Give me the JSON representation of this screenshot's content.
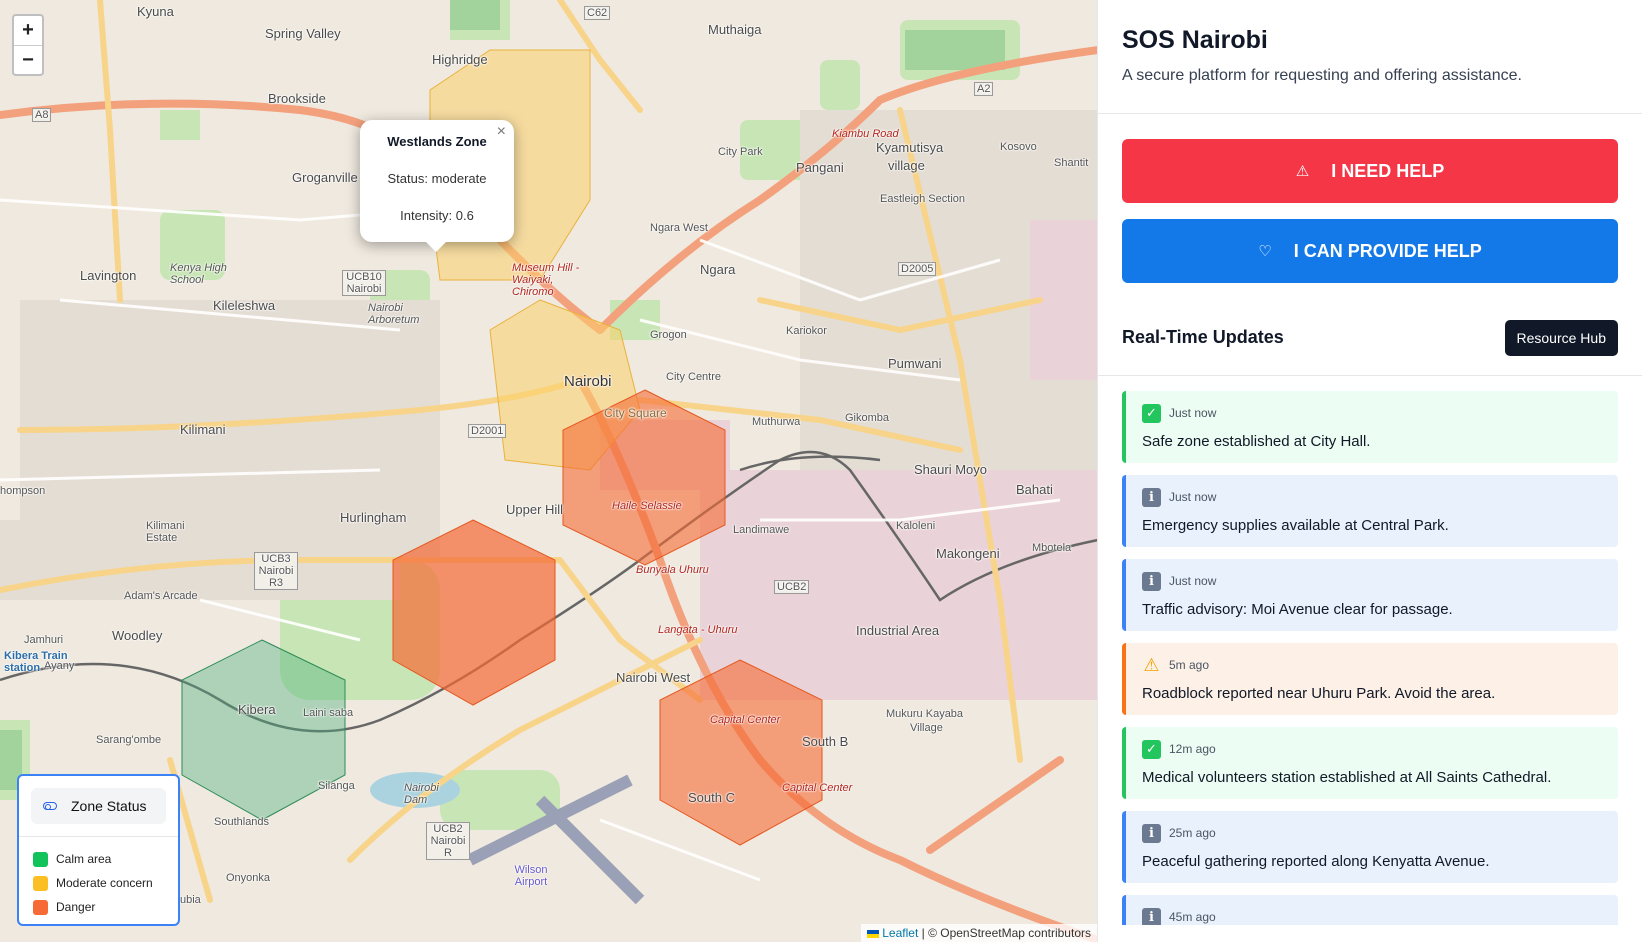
{
  "map": {
    "zoom_in": "+",
    "zoom_out": "−",
    "popup": {
      "title": "Westlands Zone",
      "status": "Status: moderate",
      "intensity": "Intensity: 0.6",
      "close": "×"
    },
    "legend": {
      "title": "Zone Status",
      "items": [
        {
          "label": "Calm area",
          "color": "#12c25a"
        },
        {
          "label": "Moderate concern",
          "color": "#fbbf24"
        },
        {
          "label": "Danger",
          "color": "#f56a36"
        }
      ]
    },
    "attribution": {
      "leaflet": "Leaflet",
      "rest": " | © OpenStreetMap contributors"
    },
    "labels": {
      "kyuna": "Kyuna",
      "spring_valley": "Spring Valley",
      "highridge": "Highridge",
      "muthaiga": "Muthaiga",
      "brookside": "Brookside",
      "groganville": "Groganville",
      "lavington": "Lavington",
      "kileleshwa": "Kileleshwa",
      "ngara_west": "Ngara West",
      "ngara": "Ngara",
      "pangani": "Pangani",
      "kyamutisya": "Kyamutisya",
      "village": "village",
      "eastleigh_section": "Eastleigh Section",
      "kosovo": "Kosovo",
      "shantit": "Shantit",
      "kariokor": "Kariokor",
      "pumwani": "Pumwani",
      "grogon": "Grogon",
      "city_centre": "City Centre",
      "nairobi": "Nairobi",
      "kilimani": "Kilimani",
      "muthurwa": "Muthurwa",
      "gikomba": "Gikomba",
      "shauri_moyo": "Shauri Moyo",
      "bahati": "Bahati",
      "upper_hill": "Upper Hill",
      "hurlingham": "Hurlingham",
      "landimawe": "Landimawe",
      "kaloleni": "Kaloleni",
      "makongeni": "Makongeni",
      "mbotela": "Mbotela",
      "industrial_area": "Industrial Area",
      "adams_arcade": "Adam's Arcade",
      "woodley": "Woodley",
      "jamhuri": "Jamhuri",
      "kibera": "Kibera",
      "laini_saba": "Laini saba",
      "nairobi_west": "Nairobi West",
      "south_b": "South B",
      "south_c": "South C",
      "mukuru": "Mukuru Kayaba",
      "mukuru_village": "Village",
      "sarangombe": "Sarang'ombe",
      "silanga": "Silanga",
      "southlands": "Southlands",
      "onyonka": "Onyonka",
      "city_park": "City Park",
      "ucb10": "UCB10 Nairobi",
      "ucb3": "UCB3 Nairobi R3",
      "ucb2a": "UCB2",
      "ucb2b": "UCB2 Nairobi R",
      "d2001": "D2001",
      "d2005": "D2005",
      "a8": "A8",
      "a2": "A2",
      "c62": "C62",
      "wilson": "Wilson Airport",
      "kibera_station": "Kibera Train station",
      "museum_hill": "Museum Hill - Waiyaki, Chiromo",
      "haile": "Haile Selassie",
      "bunyala": "Bunyala Uhuru",
      "langata": "Langata - Uhuru",
      "capital_centre": "Capital Center",
      "kiambu_road": "Kiambu Road",
      "city_square": "City Square",
      "ayany": "Ayany",
      "thompson": "hompson",
      "nairobi_dam": "Nairobi Dam",
      "kilimani_estate": "Kilimani Estate",
      "kenya_high": "Kenya High School",
      "arboretum": "Nairobi Arboretum",
      "ubia": "ubia"
    }
  },
  "sidebar": {
    "title": "SOS Nairobi",
    "subtitle": "A secure platform for requesting and offering assistance.",
    "need_help": "I NEED HELP",
    "provide_help": "I CAN PROVIDE HELP",
    "updates_title": "Real-Time Updates",
    "resource_hub": "Resource Hub",
    "updates": [
      {
        "type": "safe",
        "time": "Just now",
        "text": "Safe zone established at City Hall."
      },
      {
        "type": "info",
        "time": "Just now",
        "text": "Emergency supplies available at Central Park."
      },
      {
        "type": "info",
        "time": "Just now",
        "text": "Traffic advisory: Moi Avenue clear for passage."
      },
      {
        "type": "warn",
        "time": "5m ago",
        "text": "Roadblock reported near Uhuru Park. Avoid the area."
      },
      {
        "type": "safe",
        "time": "12m ago",
        "text": "Medical volunteers station established at All Saints Cathedral."
      },
      {
        "type": "info",
        "time": "25m ago",
        "text": "Peaceful gathering reported along Kenyatta Avenue."
      },
      {
        "type": "info",
        "time": "45m ago",
        "text": ""
      }
    ]
  }
}
